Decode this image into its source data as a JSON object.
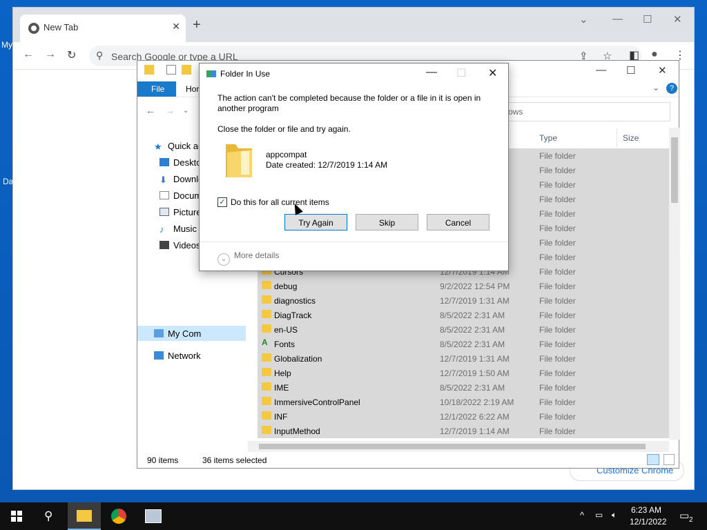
{
  "desktop": {
    "icons": [
      {
        "label": "My",
        "icon": "pc-icon"
      },
      {
        "label": "Da",
        "icon": "folder-icon"
      }
    ]
  },
  "chrome": {
    "tab_title": "New Tab",
    "new_tab_symbol": "+",
    "close_symbol": "✕",
    "omnibox_placeholder": "Search Google or type a URL",
    "customize_label": "Customize Chrome"
  },
  "explorer": {
    "ribbon": {
      "file": "File",
      "home": "Hom"
    },
    "search_placeholder": "ows",
    "columns": {
      "type": "Type",
      "size": "Size"
    },
    "sidebar": [
      {
        "label": "Quick ac",
        "icon": "star-icon"
      },
      {
        "label": "Deskto",
        "icon": "desktop-icon"
      },
      {
        "label": "Downlo",
        "icon": "download-icon"
      },
      {
        "label": "Docum",
        "icon": "document-icon"
      },
      {
        "label": "Picture",
        "icon": "picture-icon"
      },
      {
        "label": "Music",
        "icon": "music-icon"
      },
      {
        "label": "Videos",
        "icon": "video-icon"
      },
      {
        "label": "My Com",
        "icon": "pc-icon"
      },
      {
        "label": "Network",
        "icon": "network-icon"
      }
    ],
    "rows": [
      {
        "name": "",
        "date": "",
        "type": "File folder"
      },
      {
        "name": "",
        "date": "M",
        "type": "File folder"
      },
      {
        "name": "",
        "date": "M",
        "type": "File folder"
      },
      {
        "name": "",
        "date": "",
        "type": "File folder"
      },
      {
        "name": "",
        "date": "M",
        "type": "File folder"
      },
      {
        "name": "",
        "date": "",
        "type": "File folder"
      },
      {
        "name": "",
        "date": "",
        "type": "File folder"
      },
      {
        "name": "",
        "date": "",
        "type": "File folder"
      },
      {
        "name": "Cursors",
        "date": "12/7/2019 1:14 AM",
        "type": "File folder"
      },
      {
        "name": "debug",
        "date": "9/2/2022 12:54 PM",
        "type": "File folder"
      },
      {
        "name": "diagnostics",
        "date": "12/7/2019 1:31 AM",
        "type": "File folder"
      },
      {
        "name": "DiagTrack",
        "date": "8/5/2022 2:31 AM",
        "type": "File folder"
      },
      {
        "name": "en-US",
        "date": "8/5/2022 2:31 AM",
        "type": "File folder"
      },
      {
        "name": "Fonts",
        "date": "8/5/2022 2:31 AM",
        "type": "File folder"
      },
      {
        "name": "Globalization",
        "date": "12/7/2019 1:31 AM",
        "type": "File folder"
      },
      {
        "name": "Help",
        "date": "12/7/2019 1:50 AM",
        "type": "File folder"
      },
      {
        "name": "IME",
        "date": "8/5/2022 2:31 AM",
        "type": "File folder"
      },
      {
        "name": "ImmersiveControlPanel",
        "date": "10/18/2022 2:19 AM",
        "type": "File folder"
      },
      {
        "name": "INF",
        "date": "12/1/2022 6:22 AM",
        "type": "File folder"
      },
      {
        "name": "InputMethod",
        "date": "12/7/2019 1:14 AM",
        "type": "File folder"
      }
    ],
    "status": {
      "items": "90 items",
      "selected": "36 items selected"
    }
  },
  "dialog": {
    "title": "Folder In Use",
    "message_line1": "The action can't be completed because the folder or a file in it is open in",
    "message_line2": "another program",
    "instruction": "Close the folder or file and try again.",
    "folder_name": "appcompat",
    "date_created": "Date created: 12/7/2019 1:14 AM",
    "checkbox_label": "Do this for all current items",
    "checkbox_checked": true,
    "buttons": {
      "try_again": "Try Again",
      "skip": "Skip",
      "cancel": "Cancel"
    },
    "more_details": "More details"
  },
  "taskbar": {
    "time": "6:23 AM",
    "date": "12/1/2022",
    "notification_count": "2"
  },
  "colors": {
    "desktop_bg": "#0b63c6",
    "file_tab": "#1979ca",
    "selection": "#d9d9d9",
    "accent": "#0078d7"
  }
}
